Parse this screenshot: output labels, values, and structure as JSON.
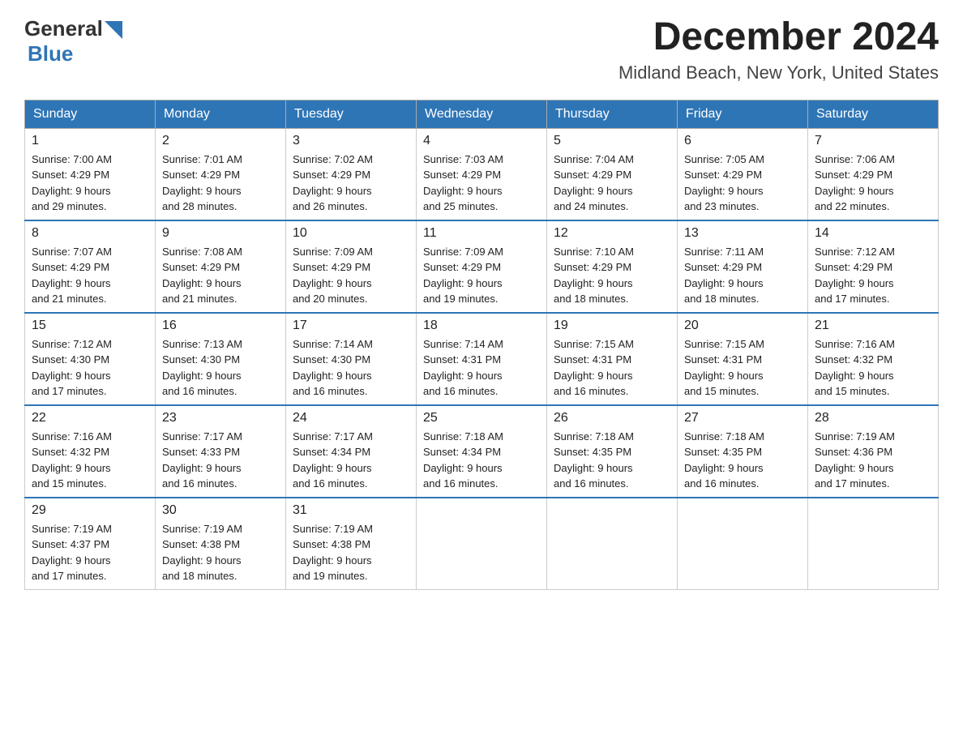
{
  "header": {
    "logo": {
      "general": "General",
      "blue": "Blue"
    },
    "title": "December 2024",
    "location": "Midland Beach, New York, United States"
  },
  "weekdays": [
    "Sunday",
    "Monday",
    "Tuesday",
    "Wednesday",
    "Thursday",
    "Friday",
    "Saturday"
  ],
  "weeks": [
    [
      {
        "day": "1",
        "sunrise": "7:00 AM",
        "sunset": "4:29 PM",
        "daylight": "9 hours and 29 minutes."
      },
      {
        "day": "2",
        "sunrise": "7:01 AM",
        "sunset": "4:29 PM",
        "daylight": "9 hours and 28 minutes."
      },
      {
        "day": "3",
        "sunrise": "7:02 AM",
        "sunset": "4:29 PM",
        "daylight": "9 hours and 26 minutes."
      },
      {
        "day": "4",
        "sunrise": "7:03 AM",
        "sunset": "4:29 PM",
        "daylight": "9 hours and 25 minutes."
      },
      {
        "day": "5",
        "sunrise": "7:04 AM",
        "sunset": "4:29 PM",
        "daylight": "9 hours and 24 minutes."
      },
      {
        "day": "6",
        "sunrise": "7:05 AM",
        "sunset": "4:29 PM",
        "daylight": "9 hours and 23 minutes."
      },
      {
        "day": "7",
        "sunrise": "7:06 AM",
        "sunset": "4:29 PM",
        "daylight": "9 hours and 22 minutes."
      }
    ],
    [
      {
        "day": "8",
        "sunrise": "7:07 AM",
        "sunset": "4:29 PM",
        "daylight": "9 hours and 21 minutes."
      },
      {
        "day": "9",
        "sunrise": "7:08 AM",
        "sunset": "4:29 PM",
        "daylight": "9 hours and 21 minutes."
      },
      {
        "day": "10",
        "sunrise": "7:09 AM",
        "sunset": "4:29 PM",
        "daylight": "9 hours and 20 minutes."
      },
      {
        "day": "11",
        "sunrise": "7:09 AM",
        "sunset": "4:29 PM",
        "daylight": "9 hours and 19 minutes."
      },
      {
        "day": "12",
        "sunrise": "7:10 AM",
        "sunset": "4:29 PM",
        "daylight": "9 hours and 18 minutes."
      },
      {
        "day": "13",
        "sunrise": "7:11 AM",
        "sunset": "4:29 PM",
        "daylight": "9 hours and 18 minutes."
      },
      {
        "day": "14",
        "sunrise": "7:12 AM",
        "sunset": "4:29 PM",
        "daylight": "9 hours and 17 minutes."
      }
    ],
    [
      {
        "day": "15",
        "sunrise": "7:12 AM",
        "sunset": "4:30 PM",
        "daylight": "9 hours and 17 minutes."
      },
      {
        "day": "16",
        "sunrise": "7:13 AM",
        "sunset": "4:30 PM",
        "daylight": "9 hours and 16 minutes."
      },
      {
        "day": "17",
        "sunrise": "7:14 AM",
        "sunset": "4:30 PM",
        "daylight": "9 hours and 16 minutes."
      },
      {
        "day": "18",
        "sunrise": "7:14 AM",
        "sunset": "4:31 PM",
        "daylight": "9 hours and 16 minutes."
      },
      {
        "day": "19",
        "sunrise": "7:15 AM",
        "sunset": "4:31 PM",
        "daylight": "9 hours and 16 minutes."
      },
      {
        "day": "20",
        "sunrise": "7:15 AM",
        "sunset": "4:31 PM",
        "daylight": "9 hours and 15 minutes."
      },
      {
        "day": "21",
        "sunrise": "7:16 AM",
        "sunset": "4:32 PM",
        "daylight": "9 hours and 15 minutes."
      }
    ],
    [
      {
        "day": "22",
        "sunrise": "7:16 AM",
        "sunset": "4:32 PM",
        "daylight": "9 hours and 15 minutes."
      },
      {
        "day": "23",
        "sunrise": "7:17 AM",
        "sunset": "4:33 PM",
        "daylight": "9 hours and 16 minutes."
      },
      {
        "day": "24",
        "sunrise": "7:17 AM",
        "sunset": "4:34 PM",
        "daylight": "9 hours and 16 minutes."
      },
      {
        "day": "25",
        "sunrise": "7:18 AM",
        "sunset": "4:34 PM",
        "daylight": "9 hours and 16 minutes."
      },
      {
        "day": "26",
        "sunrise": "7:18 AM",
        "sunset": "4:35 PM",
        "daylight": "9 hours and 16 minutes."
      },
      {
        "day": "27",
        "sunrise": "7:18 AM",
        "sunset": "4:35 PM",
        "daylight": "9 hours and 16 minutes."
      },
      {
        "day": "28",
        "sunrise": "7:19 AM",
        "sunset": "4:36 PM",
        "daylight": "9 hours and 17 minutes."
      }
    ],
    [
      {
        "day": "29",
        "sunrise": "7:19 AM",
        "sunset": "4:37 PM",
        "daylight": "9 hours and 17 minutes."
      },
      {
        "day": "30",
        "sunrise": "7:19 AM",
        "sunset": "4:38 PM",
        "daylight": "9 hours and 18 minutes."
      },
      {
        "day": "31",
        "sunrise": "7:19 AM",
        "sunset": "4:38 PM",
        "daylight": "9 hours and 19 minutes."
      },
      null,
      null,
      null,
      null
    ]
  ],
  "labels": {
    "sunrise": "Sunrise:",
    "sunset": "Sunset:",
    "daylight": "Daylight:"
  }
}
